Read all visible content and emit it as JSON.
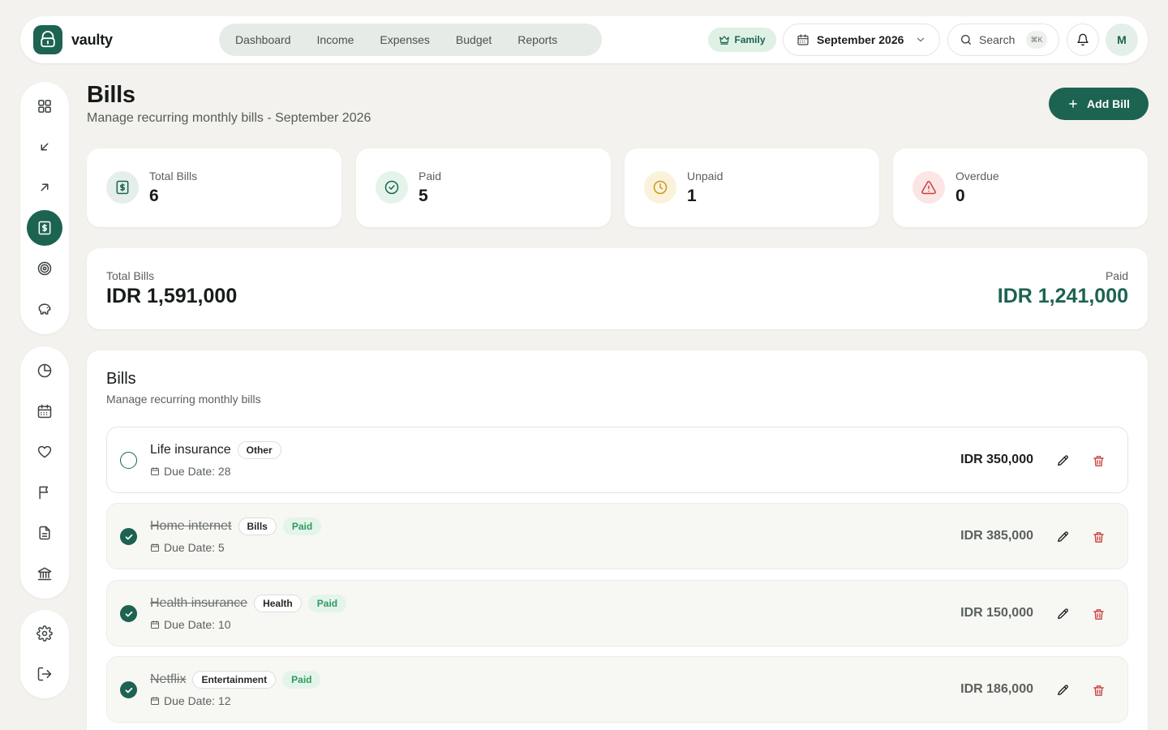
{
  "app": {
    "name": "vaulty"
  },
  "nav": {
    "items": [
      {
        "label": "Dashboard"
      },
      {
        "label": "Income"
      },
      {
        "label": "Expenses"
      },
      {
        "label": "Budget"
      },
      {
        "label": "Reports"
      }
    ]
  },
  "topbar": {
    "family_label": "Family",
    "month": "September 2026",
    "search_label": "Search",
    "search_shortcut": "⌘K",
    "avatar_initial": "M"
  },
  "sidebar": {
    "groups": [
      [
        "grid-icon",
        "arrow-down-left-icon",
        "arrow-up-right-icon",
        "bill-icon",
        "target-icon",
        "piggy-bank-icon"
      ],
      [
        "pie-chart-icon",
        "calendar-icon",
        "heart-icon",
        "flag-icon",
        "document-icon",
        "bank-icon"
      ],
      [
        "settings-icon",
        "logout-icon"
      ]
    ],
    "active": "bill-icon"
  },
  "header": {
    "title": "Bills",
    "subtitle": "Manage recurring monthly bills - September 2026",
    "add_button": "Add Bill"
  },
  "stats": [
    {
      "label": "Total Bills",
      "value": "6",
      "icon": "bill-icon",
      "color": "#1c6351"
    },
    {
      "label": "Paid",
      "value": "5",
      "icon": "check-circle-icon",
      "color": "#1c6351"
    },
    {
      "label": "Unpaid",
      "value": "1",
      "icon": "clock-icon",
      "color": "#c99a1b"
    },
    {
      "label": "Overdue",
      "value": "0",
      "icon": "warning-icon",
      "color": "#c9403c"
    }
  ],
  "summary": {
    "total_label": "Total Bills",
    "total_value": "IDR 1,591,000",
    "paid_label": "Paid",
    "paid_value": "IDR 1,241,000"
  },
  "bills": {
    "title": "Bills",
    "subtitle": "Manage recurring monthly bills",
    "rows": [
      {
        "name": "Life insurance",
        "category": "Other",
        "status": "",
        "due": "Due Date: 28",
        "amount": "IDR 350,000",
        "paid": false
      },
      {
        "name": "Home internet",
        "category": "Bills",
        "status": "Paid",
        "due": "Due Date: 5",
        "amount": "IDR 385,000",
        "paid": true
      },
      {
        "name": "Health insurance",
        "category": "Health",
        "status": "Paid",
        "due": "Due Date: 10",
        "amount": "IDR 150,000",
        "paid": true
      },
      {
        "name": "Netflix",
        "category": "Entertainment",
        "status": "Paid",
        "due": "Due Date: 12",
        "amount": "IDR 186,000",
        "paid": true
      }
    ]
  },
  "colors": {
    "brand": "#1c6351",
    "background": "#f3f2ee",
    "danger": "#c9403c",
    "warning": "#c99a1b",
    "success": "#2e9a5f"
  }
}
